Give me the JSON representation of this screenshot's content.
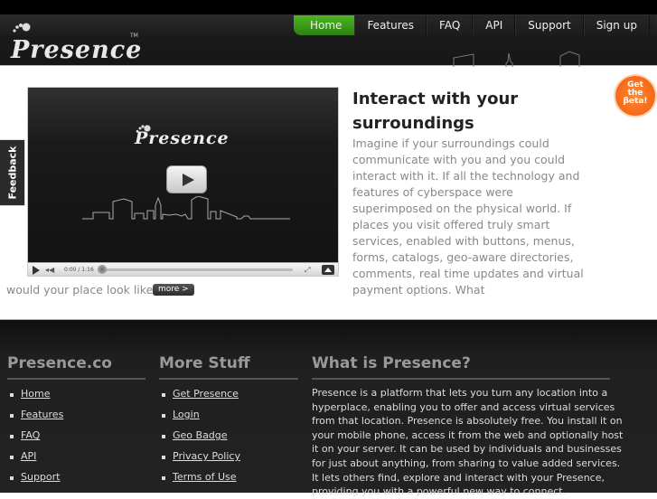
{
  "header": {
    "logo_text": "Presence",
    "trademark": "TM",
    "nav": [
      {
        "label": "Home",
        "active": true
      },
      {
        "label": "Features",
        "active": false
      },
      {
        "label": "FAQ",
        "active": false
      },
      {
        "label": "API",
        "active": false
      },
      {
        "label": "Support",
        "active": false
      },
      {
        "label": "Sign up",
        "active": false
      }
    ]
  },
  "feedback_tab": {
    "label": "Feedback"
  },
  "beta_badge": {
    "line1": "Get",
    "line2": "the",
    "line3": "βeta!",
    "color": "#f26a12"
  },
  "video": {
    "logo_text": "Presence",
    "time": "0:00 / 1:16",
    "progress": 0
  },
  "hero": {
    "title": "Interact with your surroundings",
    "body": "Imagine if your surroundings could communicate with you and you could interact with it. If all the technology and features of cyberspace were superimposed on the physical world. If places you visit offered truly smart services, enabled with buttons, menus, forms, catalogs, geo-aware directories, comments, real time updates and virtual payment options. What",
    "body_cont": "would your place look like?",
    "more_label": "more >"
  },
  "footer": {
    "col1": {
      "title": "Presence.co",
      "links": [
        "Home",
        "Features",
        "FAQ",
        "API",
        "Support"
      ]
    },
    "col2": {
      "title": "More Stuff",
      "links": [
        "Get Presence",
        "Login",
        "Geo Badge",
        "Privacy Policy",
        "Terms of Use"
      ]
    },
    "col3": {
      "title": "What is Presence?",
      "text": "Presence is a platform that lets you turn any location into a hyperplace, enabling you to offer and access virtual services from that location. Presence is absolutely free. You install it on your mobile phone, access it from the web and optionally host it on your server. It can be used by individuals and businesses for just about anything, from sharing to value added services. It lets others find, explore and interact with your Presence, providing you with a powerful new way to connect."
    }
  },
  "colors": {
    "nav_active": "#3a9a18",
    "header_bg": "#1a1a1a",
    "footer_bg": "#222222"
  }
}
